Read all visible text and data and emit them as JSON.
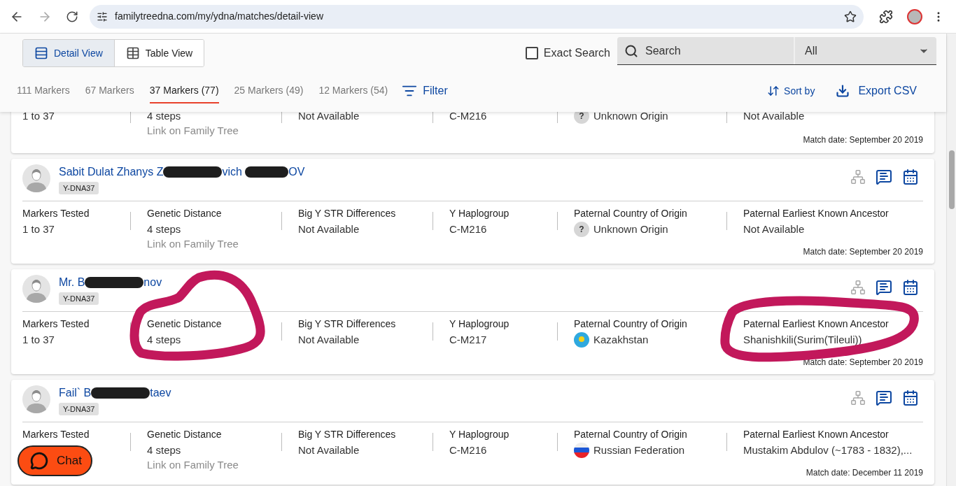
{
  "browser": {
    "url": "familytreedna.com/my/ydna/matches/detail-view"
  },
  "views": [
    {
      "label": "Detail View",
      "selected": true,
      "kind": "detail"
    },
    {
      "label": "Table View",
      "selected": false,
      "kind": "table"
    }
  ],
  "exact_search": {
    "label": "Exact Search",
    "checked": false
  },
  "search": {
    "placeholder": "Search",
    "scope": "All"
  },
  "marker_tabs": [
    {
      "label": "111 Markers",
      "selected": false
    },
    {
      "label": "67 Markers",
      "selected": false
    },
    {
      "label": "37 Markers (77)",
      "selected": true
    },
    {
      "label": "25 Markers (49)",
      "selected": false
    },
    {
      "label": "12 Markers (54)",
      "selected": false
    }
  ],
  "filter": "Filter",
  "sort": "Sort by",
  "export": "Export CSV",
  "matches": [
    {
      "kind": "partial",
      "columns": [
        {
          "value": "1 to 37"
        },
        {
          "value": "4 steps",
          "link": "Link on Family Tree"
        },
        {
          "value": "Not Available"
        },
        {
          "value": "C-M216"
        },
        {
          "value": "Unknown Origin",
          "flag": {
            "kind": "question",
            "text": "?"
          }
        },
        {
          "value": "Not Available"
        }
      ],
      "match_date": "Match date: September 20 2019"
    },
    {
      "kind": "full",
      "name_parts": [
        "Sabit Dulat Zhanys Z",
        "vich ",
        "OV"
      ],
      "badge": "Y-DNA37",
      "columns": [
        {
          "heading": "Markers Tested",
          "value": "1 to 37"
        },
        {
          "heading": "Genetic Distance",
          "value": "4 steps",
          "link": "Link on Family Tree"
        },
        {
          "heading": "Big Y STR Differences",
          "value": "Not Available"
        },
        {
          "heading": "Y Haplogroup",
          "value": "C-M216"
        },
        {
          "heading": "Paternal Country of Origin",
          "value": "Unknown Origin",
          "flag": {
            "kind": "question",
            "text": "?"
          }
        },
        {
          "heading": "Paternal Earliest Known Ancestor",
          "value": "Not Available"
        }
      ],
      "match_date": "Match date: September 20 2019",
      "annotated": false
    },
    {
      "kind": "full",
      "name_parts": [
        "Mr. B",
        "nov"
      ],
      "badge": "Y-DNA37",
      "columns": [
        {
          "heading": "Markers Tested",
          "value": "1 to 37"
        },
        {
          "heading": "Genetic Distance",
          "value": "4 steps"
        },
        {
          "heading": "Big Y STR Differences",
          "value": "Not Available"
        },
        {
          "heading": "Y Haplogroup",
          "value": "C-M217"
        },
        {
          "heading": "Paternal Country of Origin",
          "value": "Kazakhstan",
          "flag": {
            "kind": "kazakhstan"
          }
        },
        {
          "heading": "Paternal Earliest Known Ancestor",
          "value": "Shanishkili(Surim(Tileuli))"
        }
      ],
      "match_date": "Match date: September 20 2019",
      "annotated": true
    },
    {
      "kind": "full",
      "name_parts": [
        "Fail` B",
        "taev"
      ],
      "badge": "Y-DNA37",
      "columns": [
        {
          "heading": "Markers Tested"
        },
        {
          "heading": "Genetic Distance",
          "value": "4 steps",
          "link": "Link on Family Tree"
        },
        {
          "heading": "Big Y STR Differences",
          "value": "Not Available"
        },
        {
          "heading": "Y Haplogroup",
          "value": "C-M216"
        },
        {
          "heading": "Paternal Country of Origin",
          "value": "Russian Federation",
          "flag": {
            "kind": "russia"
          }
        },
        {
          "heading": "Paternal Earliest Known Ancestor",
          "value": "Mustakim Abdulov (~1783 - 1832),..."
        }
      ],
      "match_date": "Match date: December 11 2019",
      "annotated": false
    }
  ],
  "chat": {
    "label": "Chat"
  }
}
